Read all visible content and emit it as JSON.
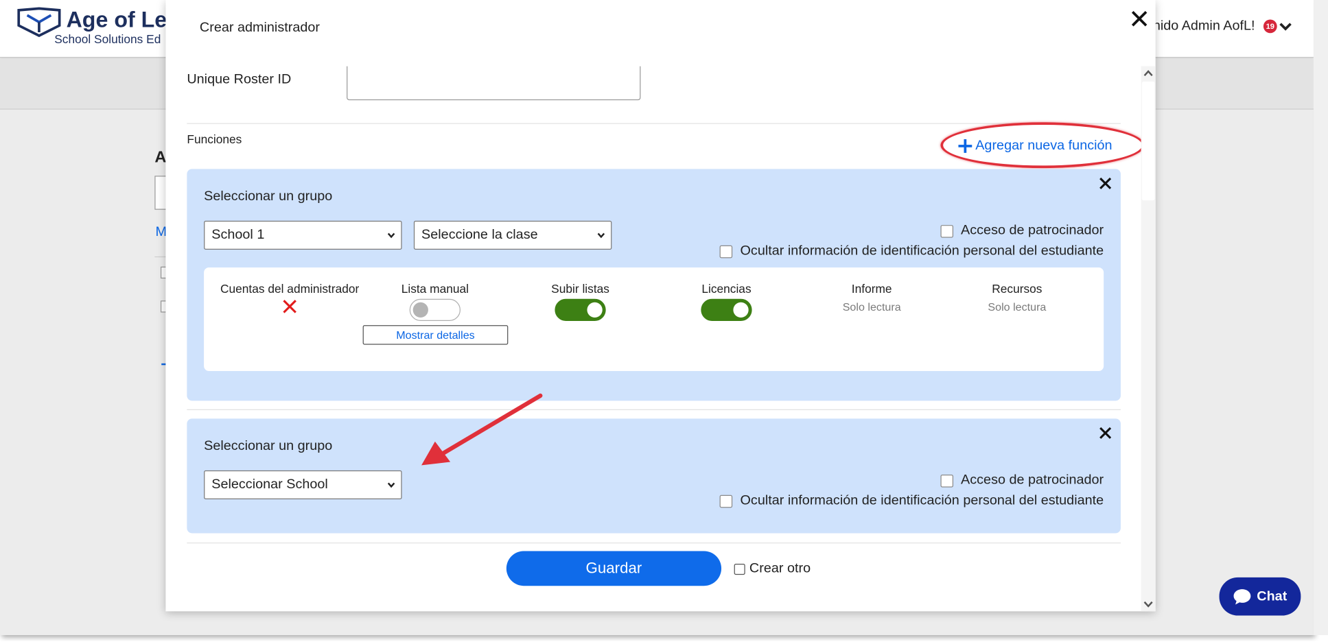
{
  "app": {
    "brand_name": "Age of Lea",
    "brand_sub": "School Solutions Ed",
    "user_greeting": "enido Admin AofL!",
    "notification_count": "19",
    "bg_heading": "A",
    "bg_link": "M"
  },
  "modal": {
    "title": "Crear administrador",
    "roster_label": "Unique Roster ID",
    "roster_value": "",
    "functions_label": "Funciones",
    "add_role_label": "Agregar nueva función",
    "save_label": "Guardar",
    "create_other_label": "Crear otro"
  },
  "groups": [
    {
      "title": "Seleccionar un grupo",
      "school_select": "School 1",
      "class_select": "Seleccione la clase",
      "sponsor_access_label": "Acceso de patrocinador",
      "hide_pii_label": "Ocultar información de identificación personal del estudiante",
      "permissions": [
        {
          "title": "Cuentas del administrador",
          "state": "denied"
        },
        {
          "title": "Lista manual",
          "state": "toggle-off",
          "details_label": "Mostrar detalles"
        },
        {
          "title": "Subir listas",
          "state": "toggle-on"
        },
        {
          "title": "Licencias",
          "state": "toggle-on"
        },
        {
          "title": "Informe",
          "state": "text",
          "value": "Solo lectura"
        },
        {
          "title": "Recursos",
          "state": "text",
          "value": "Solo lectura"
        }
      ]
    },
    {
      "title": "Seleccionar un grupo",
      "school_select": "Seleccionar School",
      "sponsor_access_label": "Acceso de patrocinador",
      "hide_pii_label": "Ocultar información de identificación personal del estudiante"
    }
  ],
  "chat": {
    "label": "Chat"
  },
  "colors": {
    "accent_blue": "#0f6bea",
    "card_blue": "#cfe2fc",
    "toggle_on": "#3d8014",
    "annotation_red": "#e0303a",
    "chat_navy": "#13279b"
  },
  "icons": {
    "logo": "shield-book-logo",
    "close": "close-icon",
    "add": "plus-icon",
    "denied": "red-x-icon",
    "caret": "chevron-down-icon",
    "chat": "chat-bubble-icon"
  }
}
